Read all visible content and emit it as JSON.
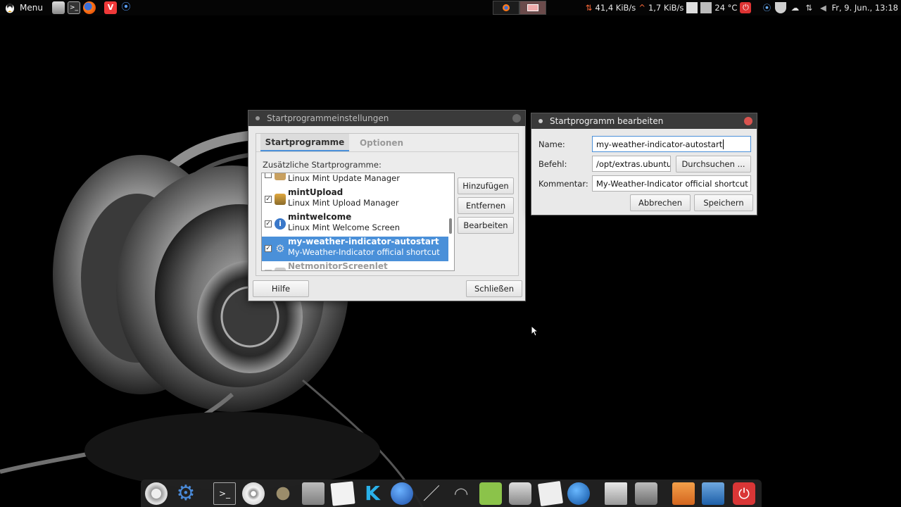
{
  "top_panel": {
    "menu_label": "Menu",
    "net_down": "41,4 KiB/s",
    "net_up": "1,7 KiB/s",
    "temperature": "24 °C",
    "clock": "Fr,  9. Jun., 13:18",
    "launchers": [
      "file-manager-icon",
      "terminal-icon",
      "firefox-icon",
      "vivaldi-icon",
      "network-icon"
    ],
    "colors": {
      "panel_bg": "#050505",
      "accent": "#4a90d9"
    }
  },
  "startup_window": {
    "title": "Startprogrammeinstellungen",
    "tabs": [
      {
        "label": "Startprogramme",
        "active": true
      },
      {
        "label": "Optionen",
        "active": false
      }
    ],
    "list_caption": "Zusätzliche Startprogramme:",
    "items": [
      {
        "title": "",
        "subtitle": "Linux Mint Update Manager",
        "checked": false,
        "selected": false,
        "icon": "update-manager-icon"
      },
      {
        "title": "mintUpload",
        "subtitle": "Linux Mint Upload Manager",
        "checked": true,
        "selected": false,
        "icon": "upload-manager-icon"
      },
      {
        "title": "mintwelcome",
        "subtitle": "Linux Mint Welcome Screen",
        "checked": true,
        "selected": false,
        "icon": "info-icon"
      },
      {
        "title": "my-weather-indicator-autostart",
        "subtitle": "My-Weather-Indicator official shortcut",
        "checked": true,
        "selected": true,
        "icon": "gear-icon"
      },
      {
        "title": "NetmonitorScreenlet",
        "subtitle": "",
        "checked": false,
        "selected": false,
        "icon": "screenlet-icon"
      }
    ],
    "buttons": {
      "add": "Hinzufügen",
      "remove": "Entfernen",
      "edit": "Bearbeiten",
      "help": "Hilfe",
      "close": "Schließen"
    }
  },
  "edit_window": {
    "title": "Startprogramm bearbeiten",
    "name_label": "Name:",
    "name_value": "my-weather-indicator-autostart",
    "command_label": "Befehl:",
    "command_value": "/opt/extras.ubuntu",
    "browse_label": "Durchsuchen ...",
    "comment_label": "Kommentar:",
    "comment_value": "My-Weather-Indicator official shortcut",
    "cancel_label": "Abbrechen",
    "save_label": "Speichern"
  },
  "dock": {
    "icons": [
      "ubuntu-logo-icon",
      "settings-gear-icon",
      "terminal-icon",
      "disc-icon",
      "gimp-icon",
      "calculator-icon",
      "text-editor-icon",
      "kodi-icon",
      "earth-icon",
      "pen-icon",
      "headphones-icon",
      "puzzle-icon",
      "scanner-icon",
      "mail-icon",
      "globe-icon",
      "screen-icon",
      "camera-icon",
      "home-folder-icon",
      "virtualbox-icon",
      "power-icon"
    ]
  }
}
